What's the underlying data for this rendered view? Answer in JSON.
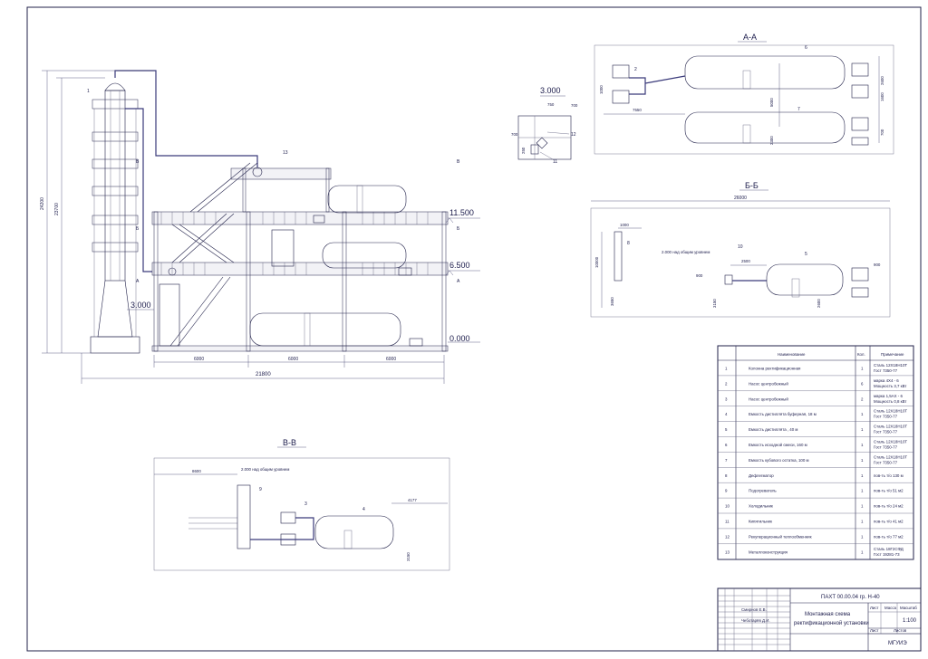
{
  "drawing": {
    "title_main": "ПАХТ 00.00.04 гр. Н-40",
    "title_name_1": "Монтажная схема",
    "title_name_2": "ректификационной установки",
    "scale": "1:100",
    "organization": "МГУИЭ",
    "sheet_label": "Лист",
    "sheets_label": "Листов",
    "mass_label": "Масса",
    "scale_label": "Масштаб",
    "developer_name": "Смирнов Е.В.",
    "checker_name": "Чеботарёв Д.И."
  },
  "main_view": {
    "levels": [
      "11.500",
      "6.500",
      "0.000",
      "3.000"
    ],
    "dims": {
      "total_width": "21800",
      "bays": [
        "6000",
        "6000",
        "6000"
      ],
      "height_1": "24200",
      "height_2": "23700"
    },
    "markers": [
      "1",
      "13",
      "В",
      "Б",
      "А"
    ]
  },
  "view_detail_3": {
    "level": "3.000",
    "dims": [
      "700",
      "750",
      "700",
      "250"
    ],
    "labels": [
      "12",
      "11"
    ]
  },
  "view_aa": {
    "title": "А-А",
    "dims": [
      "1000",
      "7550",
      "5000",
      "2600",
      "1600",
      "2300",
      "700"
    ],
    "labels": [
      "2",
      "6",
      "7"
    ]
  },
  "view_bb": {
    "title": "Б-Б",
    "dims": [
      "26000",
      "1000",
      "10000",
      "2500",
      "900",
      "900",
      "3650",
      "3150",
      "2600"
    ],
    "note": "2.000 над общим уровнем",
    "labels": [
      "8",
      "10",
      "5"
    ]
  },
  "view_vv": {
    "title": "В-В",
    "dims": [
      "8600",
      "4177",
      "3150"
    ],
    "note": "2.000 над общим уровнем",
    "labels": [
      "9",
      "3",
      "4"
    ]
  },
  "spec_table": {
    "headers": [
      "Наименование",
      "Кол.",
      "Примечание"
    ],
    "rows": [
      {
        "num": "1",
        "name": "Колонна ректификационная",
        "qty": "1",
        "note1": "Сталь 12Х18Н10Т",
        "note2": "Гост 7350-77"
      },
      {
        "num": "2",
        "name": "Насос центробежный",
        "qty": "6",
        "note1": "марка 4Х4 - 6",
        "note2": "Мощность 3,7 кВт"
      },
      {
        "num": "3",
        "name": "Насос центробежный",
        "qty": "2",
        "note1": "марка 1,5АХ - 6",
        "note2": "Мощность 0,8 кВт"
      },
      {
        "num": "4",
        "name": "Емкость дистиллята буферная, 18 м",
        "qty": "1",
        "note1": "Сталь 12Х18Н10Т",
        "note2": "Гост 7350-77"
      },
      {
        "num": "5",
        "name": "Емкость дистиллята , 40 м",
        "qty": "1",
        "note1": "Сталь 12Х18Н10Т",
        "note2": "Гост 7350-77"
      },
      {
        "num": "6",
        "name": "Емкость исходной смеси, 160 м",
        "qty": "1",
        "note1": "Сталь 12Х18Н10Т",
        "note2": "Гост 7350-77"
      },
      {
        "num": "7",
        "name": "Емкость кубового остатка, 100 м",
        "qty": "1",
        "note1": "Сталь 12Х18Н10Т",
        "note2": "Гост 7350-77"
      },
      {
        "num": "8",
        "name": "Дефлегматор",
        "qty": "1",
        "note1": "пов-ть т/о 130 м",
        "note2": ""
      },
      {
        "num": "9",
        "name": "Подогреватель",
        "qty": "1",
        "note1": "пов-ть т/о 51 м2",
        "note2": ""
      },
      {
        "num": "10",
        "name": "Холодильник",
        "qty": "1",
        "note1": "пов-ть т/о 24 м2",
        "note2": ""
      },
      {
        "num": "11",
        "name": "Кипятильник",
        "qty": "1",
        "note1": "пов-ть т/о 41 м2",
        "note2": ""
      },
      {
        "num": "12",
        "name": "Рекуперационный теплообменник",
        "qty": "1",
        "note1": "пов-ть т/о 77 м2",
        "note2": ""
      },
      {
        "num": "13",
        "name": "Металлоконструкция",
        "qty": "1",
        "note1": "Сталь 18Г2СФД",
        "note2": "Гост 19281-73"
      }
    ]
  }
}
